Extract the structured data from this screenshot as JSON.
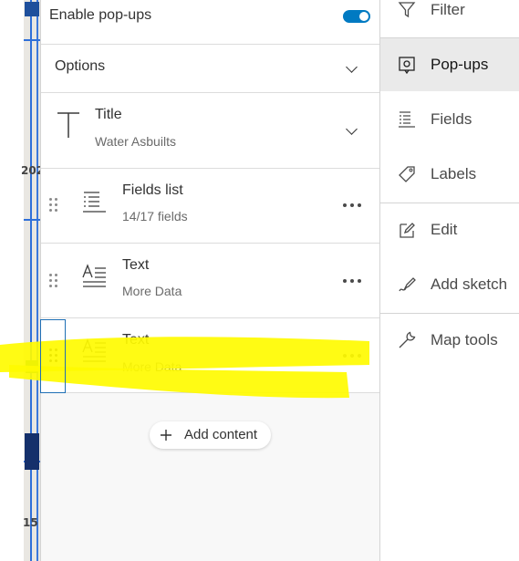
{
  "map": {
    "labels": [
      "202",
      "15"
    ]
  },
  "panel": {
    "enable_popups": {
      "label": "Enable pop-ups",
      "enabled": true
    },
    "options": {
      "label": "Options"
    },
    "title_block": {
      "label": "Title",
      "value": "Water Asbuilts"
    },
    "blocks": [
      {
        "type": "fields-list",
        "label": "Fields list",
        "sub": "14/17 fields"
      },
      {
        "type": "text",
        "label": "Text",
        "sub": "More Data"
      },
      {
        "type": "text",
        "label": "Text",
        "sub": "More Data",
        "highlighted": true
      }
    ],
    "add_content": {
      "label": "Add content"
    }
  },
  "toolbar": {
    "items": [
      {
        "label": "Filter",
        "icon": "filter-icon"
      },
      {
        "label": "Pop-ups",
        "icon": "popup-icon",
        "active": true
      },
      {
        "label": "Fields",
        "icon": "fields-icon"
      },
      {
        "label": "Labels",
        "icon": "label-tag-icon"
      },
      {
        "label": "Edit",
        "icon": "edit-icon"
      },
      {
        "label": "Add sketch",
        "icon": "sketch-icon"
      },
      {
        "label": "Map tools",
        "icon": "wrench-icon"
      }
    ]
  },
  "colors": {
    "accent": "#007ac2",
    "highlight": "#fffb00",
    "active_tab": "#eaeaea"
  }
}
